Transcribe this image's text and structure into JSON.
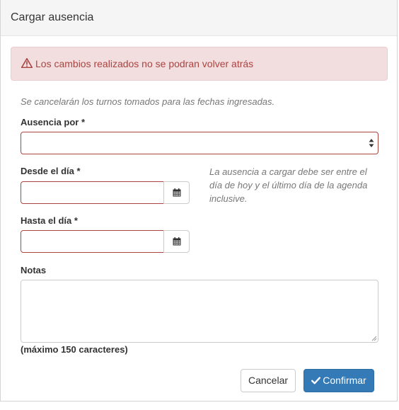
{
  "modal": {
    "title": "Cargar ausencia"
  },
  "alert": {
    "icon": "warning-icon",
    "text": "Los cambios realizados no se podran volver atrás",
    "color": "#a94442",
    "background": "#f2dede"
  },
  "note": "Se cancelarán los turnos tomados para las fechas ingresadas.",
  "fields": {
    "ausencia_label": "Ausencia por *",
    "ausencia_value": "",
    "desde_label": "Desde el día *",
    "desde_value": "",
    "hasta_label": "Hasta el día *",
    "hasta_value": "",
    "notas_label": "Notas",
    "notas_value": "",
    "max_chars": "(máximo 150 caracteres)",
    "calendar_icon": "calendar-icon"
  },
  "help_text": "La ausencia a cargar debe ser entre el día de hoy y el último día de la agenda inclusive.",
  "buttons": {
    "cancel": "Cancelar",
    "confirm": "Confirmar",
    "confirm_icon": "check-icon",
    "primary_color": "#337ab7"
  }
}
